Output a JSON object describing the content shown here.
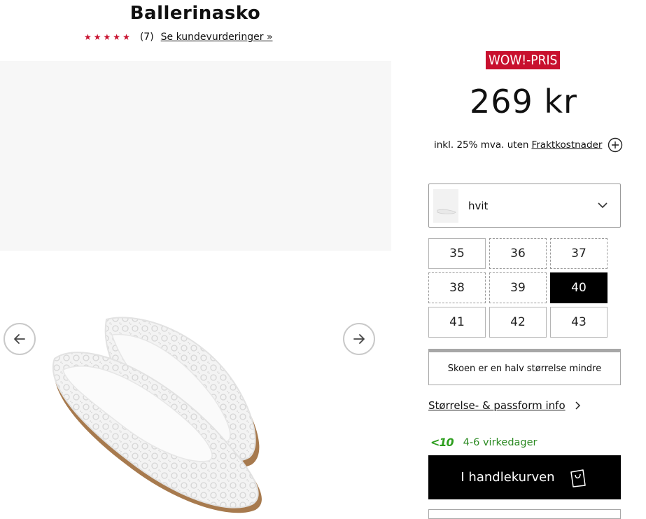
{
  "product": {
    "title": "Ballerinasko",
    "rating_stars": 5,
    "review_count": "(7)",
    "review_link": "Se kundevurderinger »"
  },
  "price": {
    "badge": "WOW!-PRIS",
    "amount": "269 kr",
    "vat_text": "inkl. 25% mva. uten",
    "shipping_link": "Fraktkostnader"
  },
  "color_select": {
    "selected": "hvit"
  },
  "sizes": [
    {
      "label": "35",
      "style": "solid"
    },
    {
      "label": "36",
      "style": "dashed"
    },
    {
      "label": "37",
      "style": "dashed"
    },
    {
      "label": "38",
      "style": "dashed"
    },
    {
      "label": "39",
      "style": "dashed"
    },
    {
      "label": "40",
      "style": "selected"
    },
    {
      "label": "41",
      "style": "solid"
    },
    {
      "label": "42",
      "style": "solid"
    },
    {
      "label": "43",
      "style": "solid"
    }
  ],
  "fit_note": "Skoen er en halv størrelse mindre",
  "size_info_link": "Størrelse- & passform info",
  "delivery": {
    "badge": "<10",
    "text": "4-6 virkedager"
  },
  "cart": {
    "label": "I handlekurven"
  },
  "colors": {
    "accent_red": "#c8102e",
    "delivery_green": "#2b8a22",
    "cart_button": "#000000"
  }
}
